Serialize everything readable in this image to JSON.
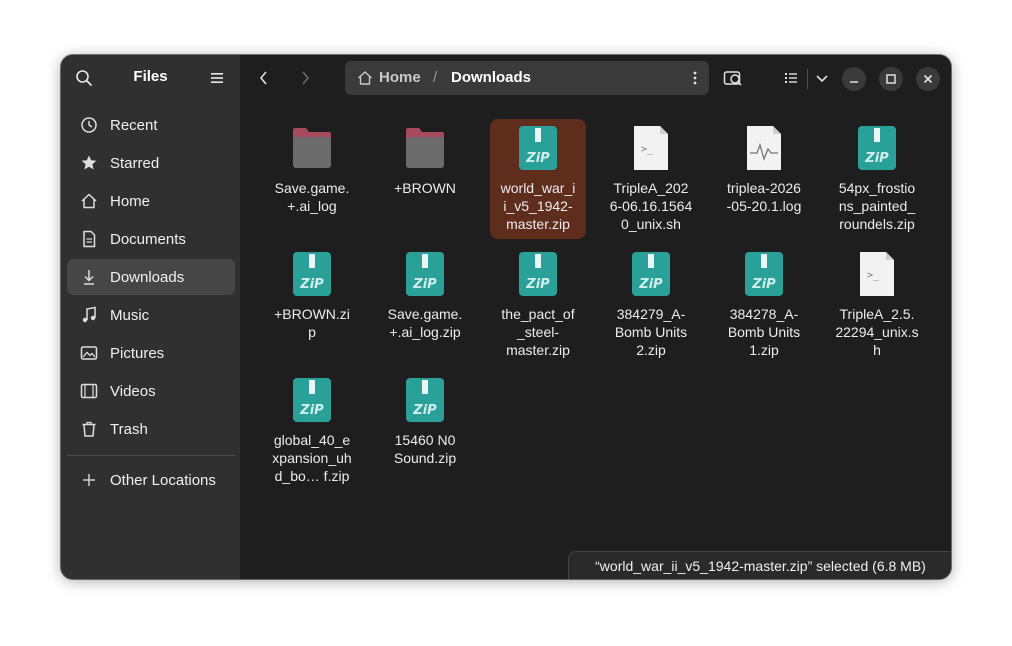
{
  "sidebar": {
    "title": "Files",
    "items": [
      {
        "label": "Recent",
        "icon": "clock-icon"
      },
      {
        "label": "Starred",
        "icon": "star-icon"
      },
      {
        "label": "Home",
        "icon": "home-icon"
      },
      {
        "label": "Documents",
        "icon": "document-icon"
      },
      {
        "label": "Downloads",
        "icon": "download-icon",
        "active": true
      },
      {
        "label": "Music",
        "icon": "music-icon"
      },
      {
        "label": "Pictures",
        "icon": "picture-icon"
      },
      {
        "label": "Videos",
        "icon": "video-icon"
      },
      {
        "label": "Trash",
        "icon": "trash-icon"
      }
    ],
    "other_locations": "Other Locations"
  },
  "pathbar": {
    "home": "Home",
    "separator": "/",
    "current": "Downloads"
  },
  "files": [
    {
      "name": "Save.game.\n+.ai_log",
      "type": "folder"
    },
    {
      "name": "+BROWN",
      "type": "folder"
    },
    {
      "name": "world_war_i\ni_v5_1942-\nmaster.zip",
      "type": "zip",
      "selected": true
    },
    {
      "name": "TripleA_202\n6-06.16.1564\n0_unix.sh",
      "type": "script"
    },
    {
      "name": "triplea-2026\n-05-20.1.log",
      "type": "log"
    },
    {
      "name": "54px_frostio\nns_painted_\nroundels.zip",
      "type": "zip"
    },
    {
      "name": "+BROWN.zi\np",
      "type": "zip"
    },
    {
      "name": "Save.game.\n+.ai_log.zip",
      "type": "zip"
    },
    {
      "name": "the_pact_of\n_steel-\nmaster.zip",
      "type": "zip"
    },
    {
      "name": "384279_A-\nBomb Units\n2.zip",
      "type": "zip"
    },
    {
      "name": "384278_A-\nBomb Units\n1.zip",
      "type": "zip"
    },
    {
      "name": "TripleA_2.5.\n22294_unix.s\nh",
      "type": "script"
    },
    {
      "name": "global_40_e\nxpansion_uh\nd_bo…  f.zip",
      "type": "zip"
    },
    {
      "name": "15460 N0\nSound.zip",
      "type": "zip"
    }
  ],
  "status": "“world_war_ii_v5_1942-master.zip” selected  (6.8 MB)",
  "colors": {
    "accent_selected": "#5e2d1c",
    "zip_teal": "#2aa198",
    "folder_body": "#6b6b6b",
    "folder_tab": "#a84a5e"
  }
}
